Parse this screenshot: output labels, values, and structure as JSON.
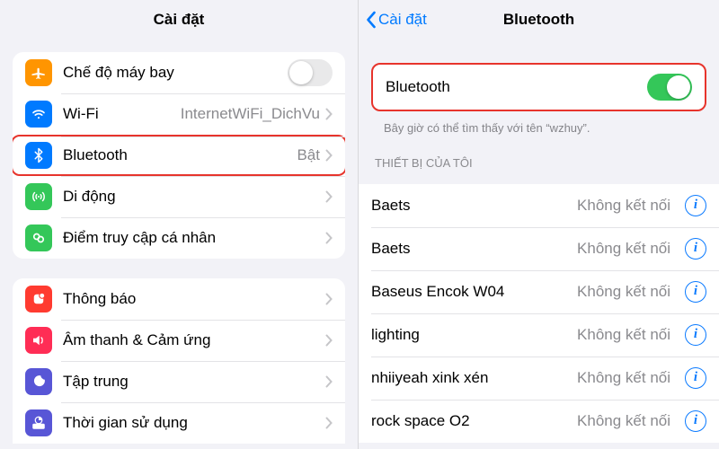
{
  "left": {
    "title": "Cài đặt",
    "group1": [
      {
        "id": "airplane",
        "icon_bg": "#ff9501",
        "label": "Chế độ máy bay",
        "toggle": false
      },
      {
        "id": "wifi",
        "icon_bg": "#007aff",
        "label": "Wi-Fi",
        "value": "InternetWiFi_DichVu",
        "chevron": true
      },
      {
        "id": "bluetooth",
        "icon_bg": "#007aff",
        "label": "Bluetooth",
        "value": "Bật",
        "chevron": true,
        "highlight": true
      },
      {
        "id": "cellular",
        "icon_bg": "#34c759",
        "label": "Di động",
        "chevron": true
      },
      {
        "id": "hotspot",
        "icon_bg": "#34c759",
        "label": "Điểm truy cập cá nhân",
        "chevron": true
      }
    ],
    "group2": [
      {
        "id": "notifications",
        "icon_bg": "#ff3b30",
        "label": "Thông báo",
        "chevron": true
      },
      {
        "id": "sounds",
        "icon_bg": "#ff2d55",
        "label": "Âm thanh & Cảm ứng",
        "chevron": true
      },
      {
        "id": "focus",
        "icon_bg": "#5856d6",
        "label": "Tập trung",
        "chevron": true
      },
      {
        "id": "screentime",
        "icon_bg": "#5856d6",
        "label": "Thời gian sử dụng",
        "chevron": true
      }
    ]
  },
  "right": {
    "back": "Cài đặt",
    "title": "Bluetooth",
    "toggle_label": "Bluetooth",
    "toggle_on": true,
    "caption": "Bây giờ có thể tìm thấy với tên “wzhuy”.",
    "devices_header": "THIẾT BỊ CỦA TÔI",
    "devices": [
      {
        "name": "Baets",
        "status": "Không kết nối"
      },
      {
        "name": "Baets",
        "status": "Không kết nối"
      },
      {
        "name": "Baseus Encok W04",
        "status": "Không kết nối"
      },
      {
        "name": "lighting",
        "status": "Không kết nối"
      },
      {
        "name": "nhiiyeah xink xén",
        "status": "Không kết nối"
      },
      {
        "name": "rock space O2",
        "status": "Không kết nối"
      }
    ]
  },
  "info_glyph": "i"
}
